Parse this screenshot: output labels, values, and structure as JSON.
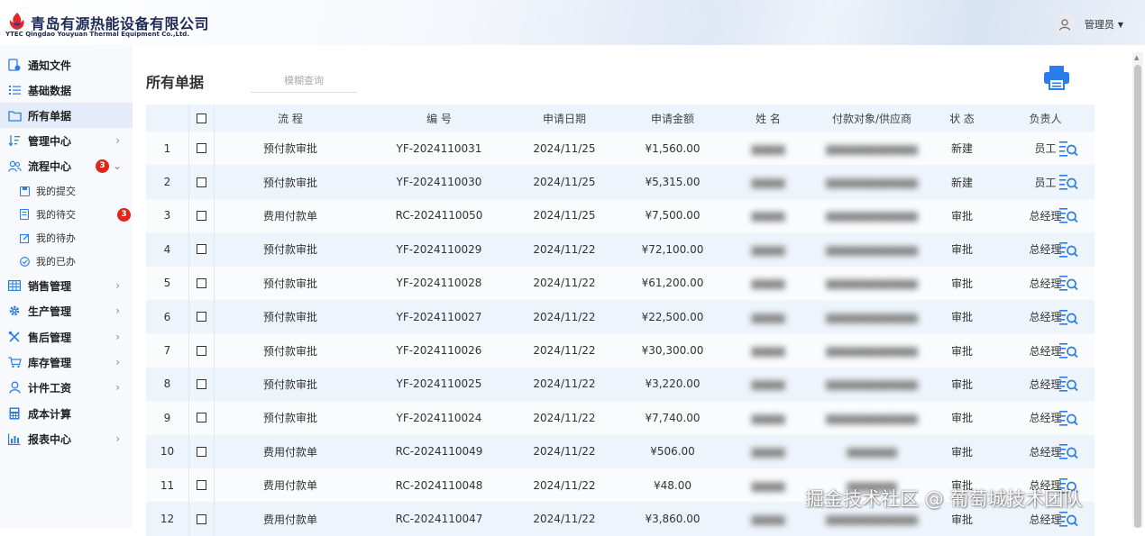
{
  "brand": {
    "name_cn": "青岛有源热能设备有限公司",
    "name_en": "YTEC Qingdao Youyuan Thermal Equipment Co.,Ltd."
  },
  "user": {
    "name": "管理员"
  },
  "sidebar": {
    "items": [
      {
        "label": "通知文件",
        "icon": "notice-file-icon"
      },
      {
        "label": "基础数据",
        "icon": "list-icon"
      },
      {
        "label": "所有单据",
        "icon": "folder-icon",
        "active": true
      },
      {
        "label": "管理中心",
        "icon": "sort-icon",
        "arrow": "›"
      },
      {
        "label": "流程中心",
        "icon": "flow-icon",
        "badge": "3",
        "arrow": "⌄"
      },
      {
        "label": "我的提交",
        "icon": "save-icon",
        "sub": true
      },
      {
        "label": "我的待交",
        "icon": "doc-icon",
        "sub": true,
        "badge": "3"
      },
      {
        "label": "我的待办",
        "icon": "edit-icon",
        "sub": true
      },
      {
        "label": "我的已办",
        "icon": "check-circle-icon",
        "sub": true
      },
      {
        "label": "销售管理",
        "icon": "table-icon",
        "arrow": "›"
      },
      {
        "label": "生产管理",
        "icon": "gear-icon",
        "arrow": "›"
      },
      {
        "label": "售后管理",
        "icon": "tools-icon",
        "arrow": "›"
      },
      {
        "label": "库存管理",
        "icon": "cart-icon",
        "arrow": "›"
      },
      {
        "label": "计件工资",
        "icon": "person-icon",
        "arrow": "›"
      },
      {
        "label": "成本计算",
        "icon": "calculator-icon"
      },
      {
        "label": "报表中心",
        "icon": "chart-icon",
        "arrow": "›"
      }
    ]
  },
  "main": {
    "title": "所有单据",
    "search_placeholder": "模糊查询",
    "print_icon": "printer-icon",
    "columns": [
      "流 程",
      "编 号",
      "申请日期",
      "申请金额",
      "姓 名",
      "付款对象/供应商",
      "状 态",
      "负责人"
    ],
    "rows": [
      {
        "idx": "1",
        "flow": "预付款审批",
        "no": "YF-2024110031",
        "date": "2024/11/25",
        "amount": "¥1,560.00",
        "name": "▆▆▆▆",
        "payee": "▆▆▆▆▆▆▆▆▆▆▆",
        "status": "新建",
        "owner": "员工"
      },
      {
        "idx": "2",
        "flow": "预付款审批",
        "no": "YF-2024110030",
        "date": "2024/11/25",
        "amount": "¥5,315.00",
        "name": "▆▆▆▆",
        "payee": "▆▆▆▆▆▆▆▆▆▆▆",
        "status": "新建",
        "owner": "员工"
      },
      {
        "idx": "3",
        "flow": "费用付款单",
        "no": "RC-2024110050",
        "date": "2024/11/25",
        "amount": "¥7,500.00",
        "name": "▆▆▆▆",
        "payee": "▆▆▆▆▆▆▆▆▆▆▆",
        "status": "审批",
        "owner": "总经理"
      },
      {
        "idx": "4",
        "flow": "预付款审批",
        "no": "YF-2024110029",
        "date": "2024/11/22",
        "amount": "¥72,100.00",
        "name": "▆▆▆▆",
        "payee": "▆▆▆▆▆▆▆▆▆▆▆",
        "status": "审批",
        "owner": "总经理"
      },
      {
        "idx": "5",
        "flow": "预付款审批",
        "no": "YF-2024110028",
        "date": "2024/11/22",
        "amount": "¥61,200.00",
        "name": "▆▆▆▆",
        "payee": "▆▆▆▆▆▆▆▆▆▆▆",
        "status": "审批",
        "owner": "总经理"
      },
      {
        "idx": "6",
        "flow": "预付款审批",
        "no": "YF-2024110027",
        "date": "2024/11/22",
        "amount": "¥22,500.00",
        "name": "▆▆▆▆",
        "payee": "▆▆▆▆▆▆▆▆▆▆▆",
        "status": "审批",
        "owner": "总经理"
      },
      {
        "idx": "7",
        "flow": "预付款审批",
        "no": "YF-2024110026",
        "date": "2024/11/22",
        "amount": "¥30,300.00",
        "name": "▆▆▆▆",
        "payee": "▆▆▆▆▆▆▆▆▆▆▆",
        "status": "审批",
        "owner": "总经理"
      },
      {
        "idx": "8",
        "flow": "预付款审批",
        "no": "YF-2024110025",
        "date": "2024/11/22",
        "amount": "¥3,220.00",
        "name": "▆▆▆▆",
        "payee": "▆▆▆▆▆▆▆▆▆▆▆",
        "status": "审批",
        "owner": "总经理"
      },
      {
        "idx": "9",
        "flow": "预付款审批",
        "no": "YF-2024110024",
        "date": "2024/11/22",
        "amount": "¥7,740.00",
        "name": "▆▆▆▆",
        "payee": "▆▆▆▆▆▆▆▆▆▆▆",
        "status": "审批",
        "owner": "总经理"
      },
      {
        "idx": "10",
        "flow": "费用付款单",
        "no": "RC-2024110049",
        "date": "2024/11/22",
        "amount": "¥506.00",
        "name": "▆▆▆▆",
        "payee": "▆▆▆▆▆▆",
        "status": "审批",
        "owner": "总经理"
      },
      {
        "idx": "11",
        "flow": "费用付款单",
        "no": "RC-2024110048",
        "date": "2024/11/22",
        "amount": "¥48.00",
        "name": "▆▆▆▆",
        "payee": "▆▆▆▆▆▆",
        "status": "审批",
        "owner": "总经理"
      },
      {
        "idx": "12",
        "flow": "费用付款单",
        "no": "RC-2024110047",
        "date": "2024/11/22",
        "amount": "¥3,860.00",
        "name": "▆▆▆▆",
        "payee": "▆▆▆▆▆▆▆▆▆▆▆",
        "status": "审批",
        "owner": "总经理"
      }
    ]
  },
  "watermark": "掘金技术社区 @ 葡萄城技术团队",
  "colors": {
    "accent": "#2b7de9",
    "badge": "#e1251b",
    "header_band": "#eef4fb",
    "active_nav": "#e3ecf8"
  }
}
